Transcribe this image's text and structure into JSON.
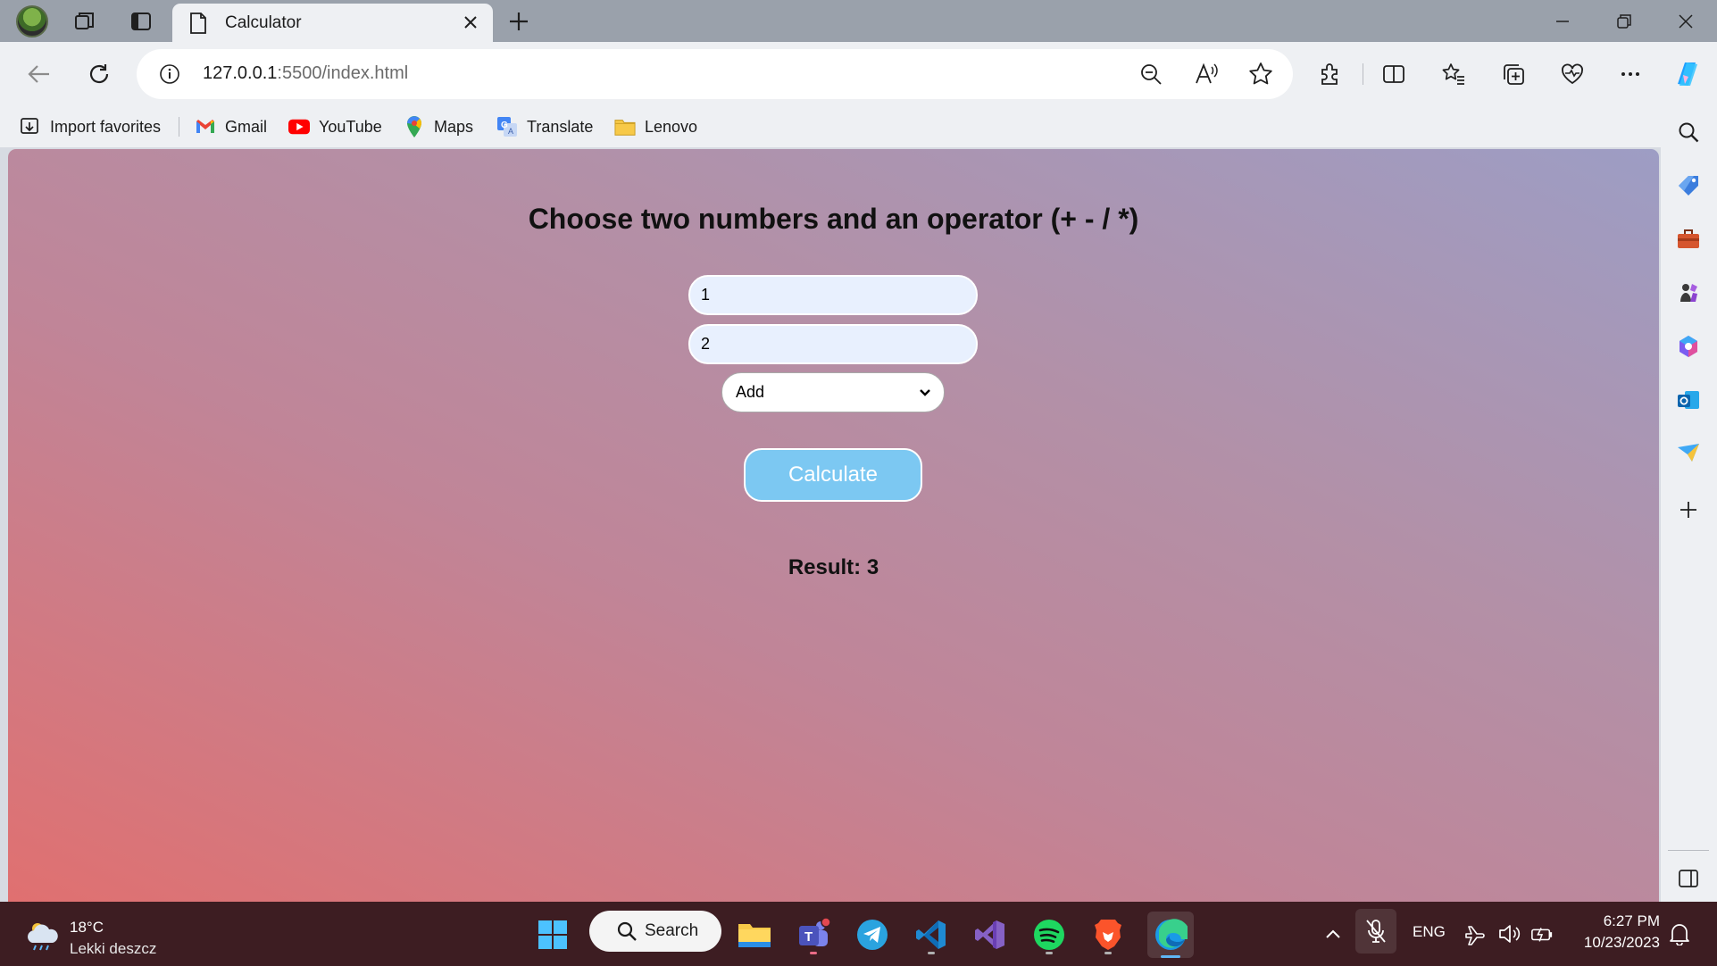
{
  "browser": {
    "tab": {
      "title": "Calculator"
    },
    "address": {
      "host": "127.0.0.1",
      "rest": ":5500/index.html"
    },
    "favorites": [
      {
        "label": "Import favorites",
        "icon": "import-favorites-icon"
      },
      {
        "label": "Gmail",
        "icon": "gmail-icon"
      },
      {
        "label": "YouTube",
        "icon": "youtube-icon"
      },
      {
        "label": "Maps",
        "icon": "maps-icon"
      },
      {
        "label": "Translate",
        "icon": "translate-icon"
      },
      {
        "label": "Lenovo",
        "icon": "folder-icon"
      }
    ]
  },
  "page": {
    "heading": "Choose two numbers and an operator (+ - / *)",
    "number1": "1",
    "number2": "2",
    "operator": "Add",
    "calculate_label": "Calculate",
    "result": "Result: 3"
  },
  "taskbar": {
    "weather_temp": "18°C",
    "weather_desc": "Lekki deszcz",
    "search_label": "Search",
    "language": "ENG",
    "time": "6:27 PM",
    "date": "10/23/2023"
  },
  "colors": {
    "calculate_button": "#7cc8f2",
    "input_fill": "#e8f0fe",
    "taskbar": "#3d1d22"
  }
}
